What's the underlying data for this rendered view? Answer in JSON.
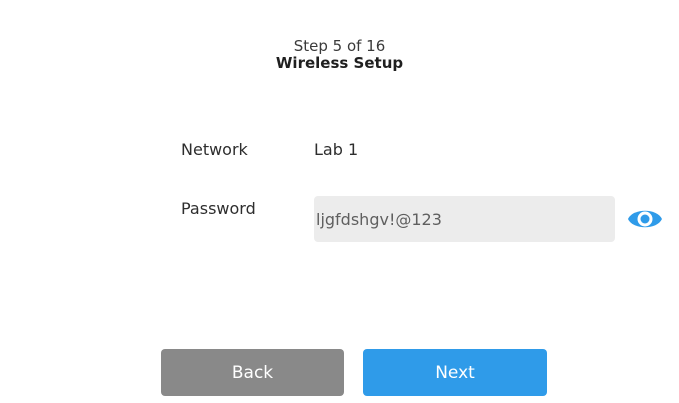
{
  "header": {
    "step": "Step 5 of 16",
    "title": "Wireless Setup"
  },
  "form": {
    "network_label": "Network",
    "network_value": "Lab 1",
    "password_label": "Password",
    "password_value": "ljgfdshgv!@123"
  },
  "icons": {
    "password_toggle": "eye-icon"
  },
  "colors": {
    "accent": "#2f9be9",
    "secondary_button": "#898989",
    "input_background": "#ececec"
  },
  "buttons": {
    "back_label": "Back",
    "next_label": "Next"
  }
}
